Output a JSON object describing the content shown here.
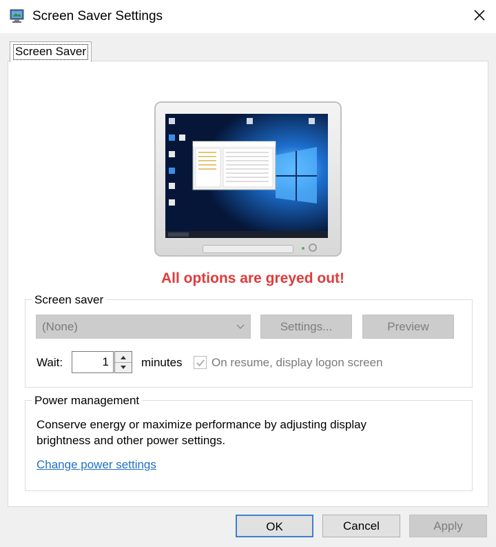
{
  "window": {
    "title": "Screen Saver Settings",
    "icon": "screen-saver-settings-icon",
    "close_icon": "close-icon"
  },
  "tabs": [
    {
      "label": "Screen Saver",
      "selected": true
    }
  ],
  "annotation": {
    "text": "All options are greyed out!",
    "color": "#e03a3a"
  },
  "screen_saver": {
    "group_title": "Screen saver",
    "selected": "(None)",
    "settings_label": "Settings...",
    "preview_label": "Preview",
    "wait_label": "Wait:",
    "wait_value": "1",
    "minutes_label": "minutes",
    "resume_label": "On resume, display logon screen",
    "resume_checked": true
  },
  "power": {
    "group_title": "Power management",
    "description_line1": "Conserve energy or maximize performance by adjusting display",
    "description_line2": "brightness and other power settings.",
    "link_text": "Change power settings"
  },
  "buttons": {
    "ok": "OK",
    "cancel": "Cancel",
    "apply": "Apply"
  },
  "colors": {
    "link": "#1f6fc5",
    "disabled_bg": "#cccccc",
    "disabled_text": "#7e7e7e",
    "ok_border": "#3c7fd1"
  }
}
